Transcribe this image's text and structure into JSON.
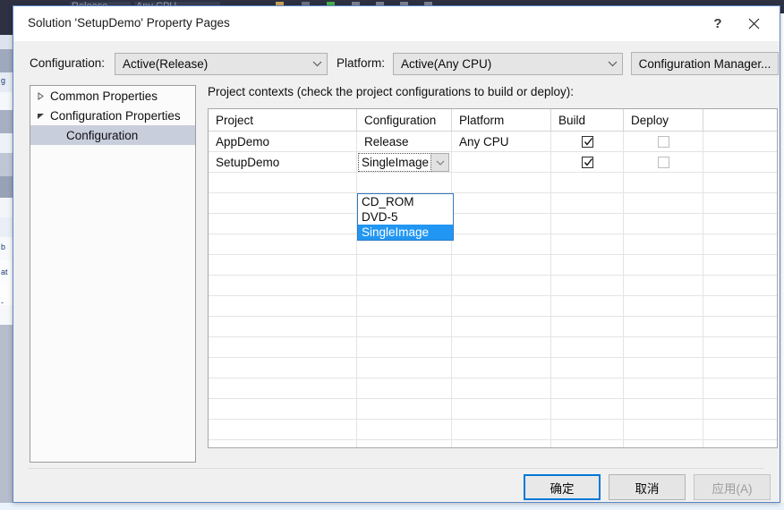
{
  "background": {
    "toolbar_items": [
      "Release",
      "Any CPU"
    ],
    "toolbar_bg": "#2d3142"
  },
  "dialog": {
    "title": "Solution 'SetupDemo' Property Pages",
    "help_button": "?",
    "close_button": "×",
    "accent_color": "#0078d7"
  },
  "toolbar": {
    "configuration_label": "Configuration:",
    "configuration_value": "Active(Release)",
    "platform_label": "Platform:",
    "platform_value": "Active(Any CPU)",
    "configuration_manager_label": "Configuration Manager..."
  },
  "tree": {
    "nodes": [
      {
        "label": "Common Properties",
        "state": "collapsed",
        "selected": false,
        "indent": 0
      },
      {
        "label": "Configuration Properties",
        "state": "expanded",
        "selected": false,
        "indent": 0
      },
      {
        "label": "Configuration",
        "state": "leaf",
        "selected": true,
        "indent": 1
      }
    ]
  },
  "main": {
    "contexts_label": "Project contexts (check the project configurations to build or deploy):",
    "columns": [
      "Project",
      "Configuration",
      "Platform",
      "Build",
      "Deploy"
    ],
    "rows": [
      {
        "project": "AppDemo",
        "configuration": "Release",
        "platform": "Any CPU",
        "build_checked": true,
        "deploy_checked": false,
        "deploy_enabled": false,
        "editing": false
      },
      {
        "project": "SetupDemo",
        "configuration": "SingleImage",
        "platform": "",
        "build_checked": true,
        "deploy_checked": false,
        "deploy_enabled": false,
        "editing": true
      }
    ],
    "dropdown": {
      "open": true,
      "options": [
        "CD_ROM",
        "DVD-5",
        "SingleImage"
      ],
      "selected": "SingleImage"
    }
  },
  "footer": {
    "ok_label": "确定",
    "cancel_label": "取消",
    "apply_label": "应用(A)",
    "apply_enabled": false
  }
}
